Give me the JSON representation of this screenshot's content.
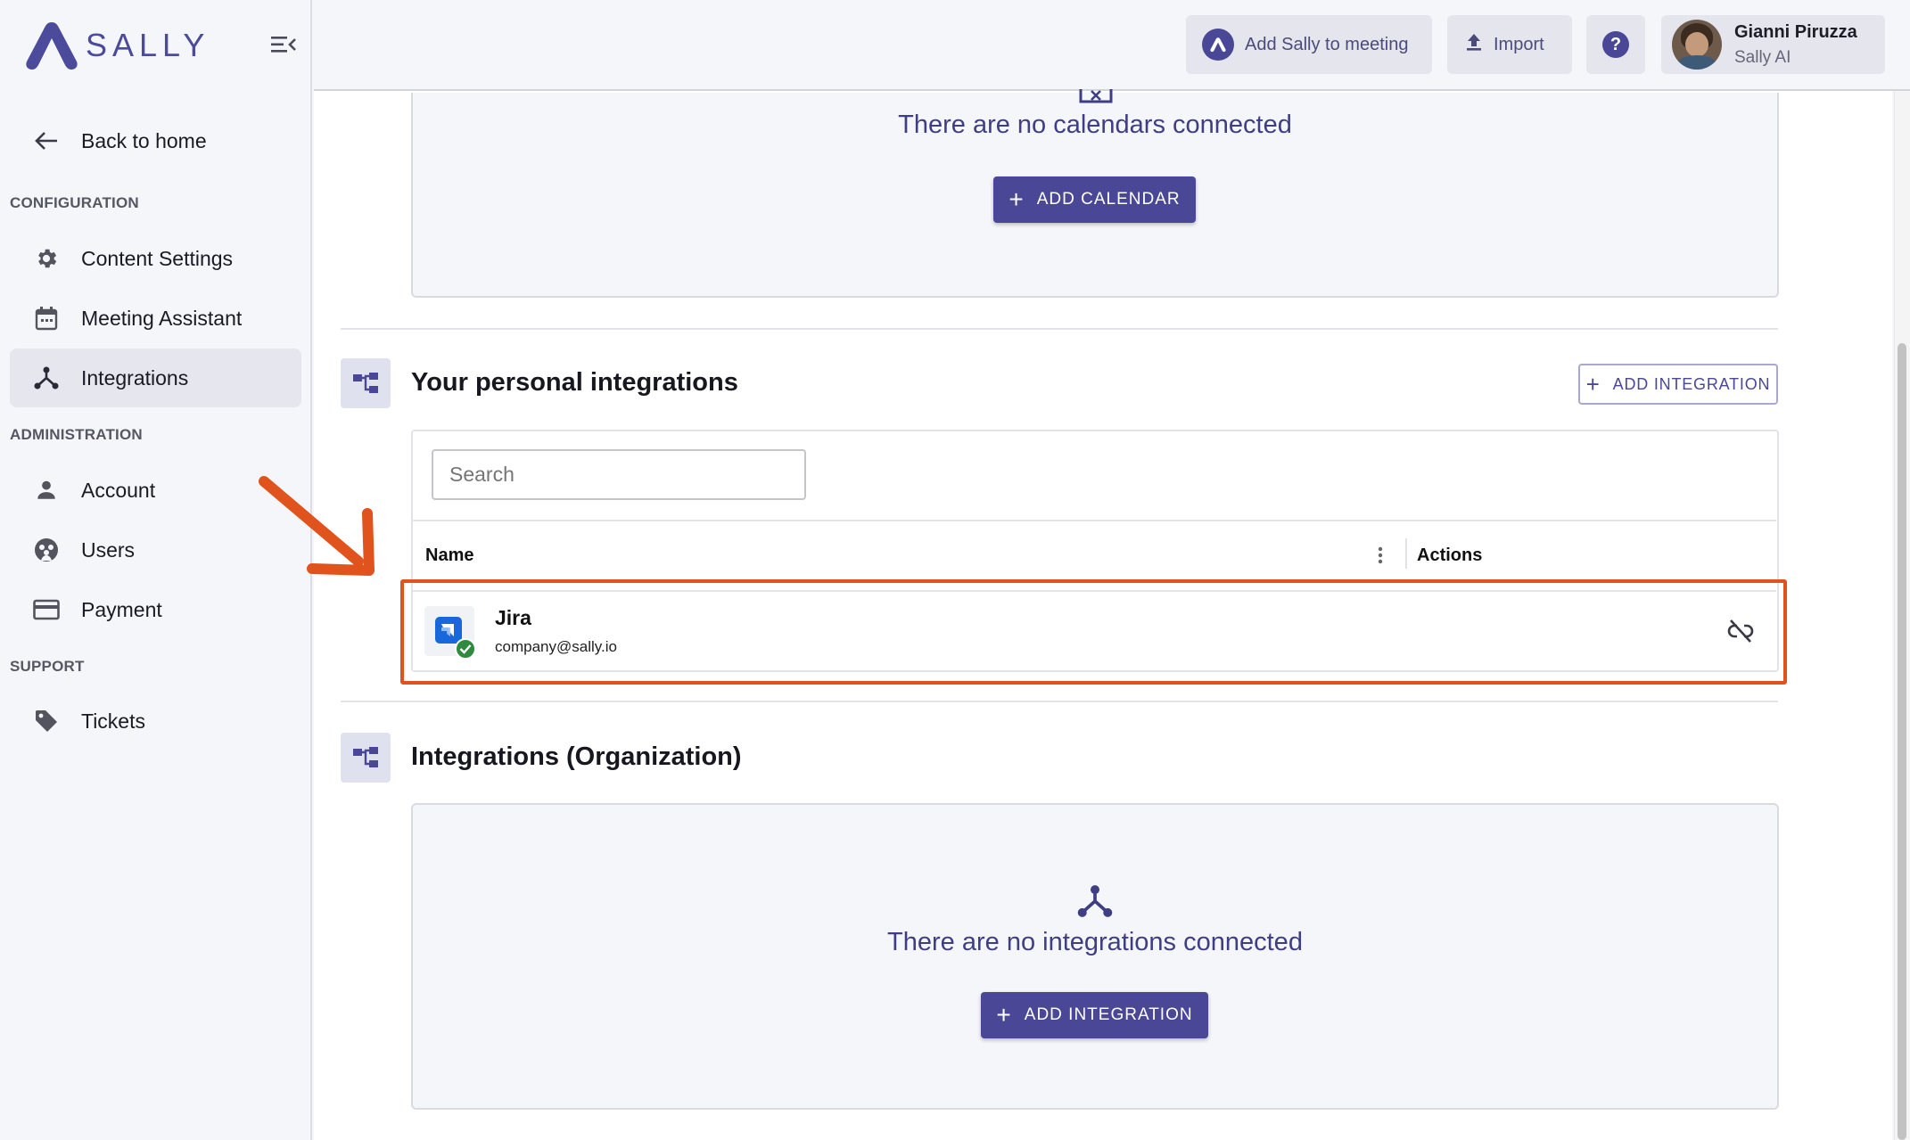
{
  "brand": {
    "name": "SALLY",
    "color": "#4c4a9b"
  },
  "sidebar": {
    "back": "Back to home",
    "sections": {
      "configuration": "CONFIGURATION",
      "administration": "ADMINISTRATION",
      "support": "SUPPORT"
    },
    "items": {
      "content_settings": "Content Settings",
      "meeting_assistant": "Meeting Assistant",
      "integrations": "Integrations",
      "account": "Account",
      "users": "Users",
      "payment": "Payment",
      "tickets": "Tickets"
    },
    "active_item": "Integrations"
  },
  "topbar": {
    "add_sally": "Add Sally to meeting",
    "import": "Import",
    "help_icon": "help-icon",
    "user": {
      "name": "Gianni Piruzza",
      "org": "Sally AI"
    }
  },
  "calendars": {
    "empty_text": "There are no calendars connected",
    "add_button": "ADD CALENDAR"
  },
  "personal_integrations": {
    "title": "Your personal integrations",
    "add_button": "ADD INTEGRATION",
    "search_placeholder": "Search",
    "columns": {
      "name": "Name",
      "actions": "Actions"
    },
    "rows": [
      {
        "name": "Jira",
        "account": "company@sally.io",
        "status": "connected",
        "action_icon": "unlink-icon"
      }
    ]
  },
  "org_integrations": {
    "title": "Integrations (Organization)",
    "empty_text": "There are no integrations connected",
    "add_button": "ADD INTEGRATION"
  },
  "colors": {
    "accent": "#4a4896",
    "highlight": "#e0531c",
    "status_ok": "#2e8b3e"
  }
}
